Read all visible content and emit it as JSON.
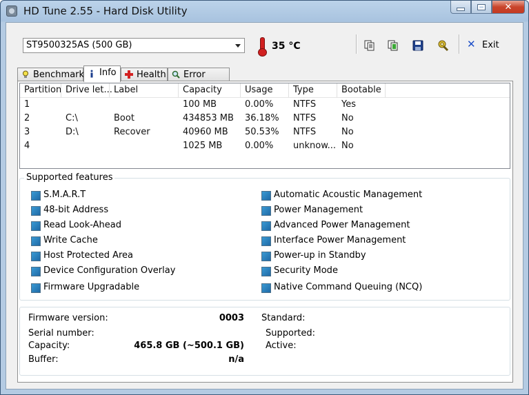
{
  "window": {
    "title": "HD Tune 2.55 - Hard Disk Utility",
    "close_glyph": "✕"
  },
  "toolbar": {
    "drive": "ST9500325AS (500 GB)",
    "temperature": "35 °C",
    "exit_label": "Exit",
    "icons": [
      "copy-text-icon",
      "copy-screenshot-icon",
      "save-icon",
      "options-icon"
    ]
  },
  "tabs": [
    {
      "label": "Benchmark",
      "icon": "lightbulb-icon"
    },
    {
      "label": "Info",
      "icon": "info-icon",
      "active": true
    },
    {
      "label": "Health",
      "icon": "health-cross-icon"
    },
    {
      "label": "Error Scan",
      "icon": "magnifier-icon"
    }
  ],
  "partitions": {
    "headers": [
      "Partition",
      "Drive let...",
      "Label",
      "Capacity",
      "Usage",
      "Type",
      "Bootable"
    ],
    "rows": [
      [
        "1",
        "",
        "",
        "100 MB",
        "0.00%",
        "NTFS",
        "Yes"
      ],
      [
        "2",
        "C:\\",
        "Boot",
        "434853 MB",
        "36.18%",
        "NTFS",
        "No"
      ],
      [
        "3",
        "D:\\",
        "Recover",
        "40960 MB",
        "50.53%",
        "NTFS",
        "No"
      ],
      [
        "4",
        "",
        "",
        "1025 MB",
        "0.00%",
        "unknow...",
        "No"
      ]
    ]
  },
  "features": {
    "title": "Supported features",
    "left": [
      "S.M.A.R.T",
      "48-bit Address",
      "Read Look-Ahead",
      "Write Cache",
      "Host Protected Area",
      "Device Configuration Overlay",
      "Firmware Upgradable"
    ],
    "right": [
      "Automatic Acoustic Management",
      "Power Management",
      "Advanced Power Management",
      "Interface Power Management",
      "Power-up in Standby",
      "Security Mode",
      "Native Command Queuing (NCQ)"
    ]
  },
  "details": {
    "firmware_label": "Firmware version:",
    "firmware_value": "0003",
    "serial_label": "Serial number:",
    "serial_value": "",
    "capacity_label": "Capacity:",
    "capacity_value": "465.8 GB (~500.1 GB)",
    "buffer_label": "Buffer:",
    "buffer_value": "n/a",
    "standard_label": "Standard:",
    "standard_value": "",
    "supported_label": "Supported:",
    "supported_value": "",
    "active_label": "Active:",
    "active_value": ""
  }
}
